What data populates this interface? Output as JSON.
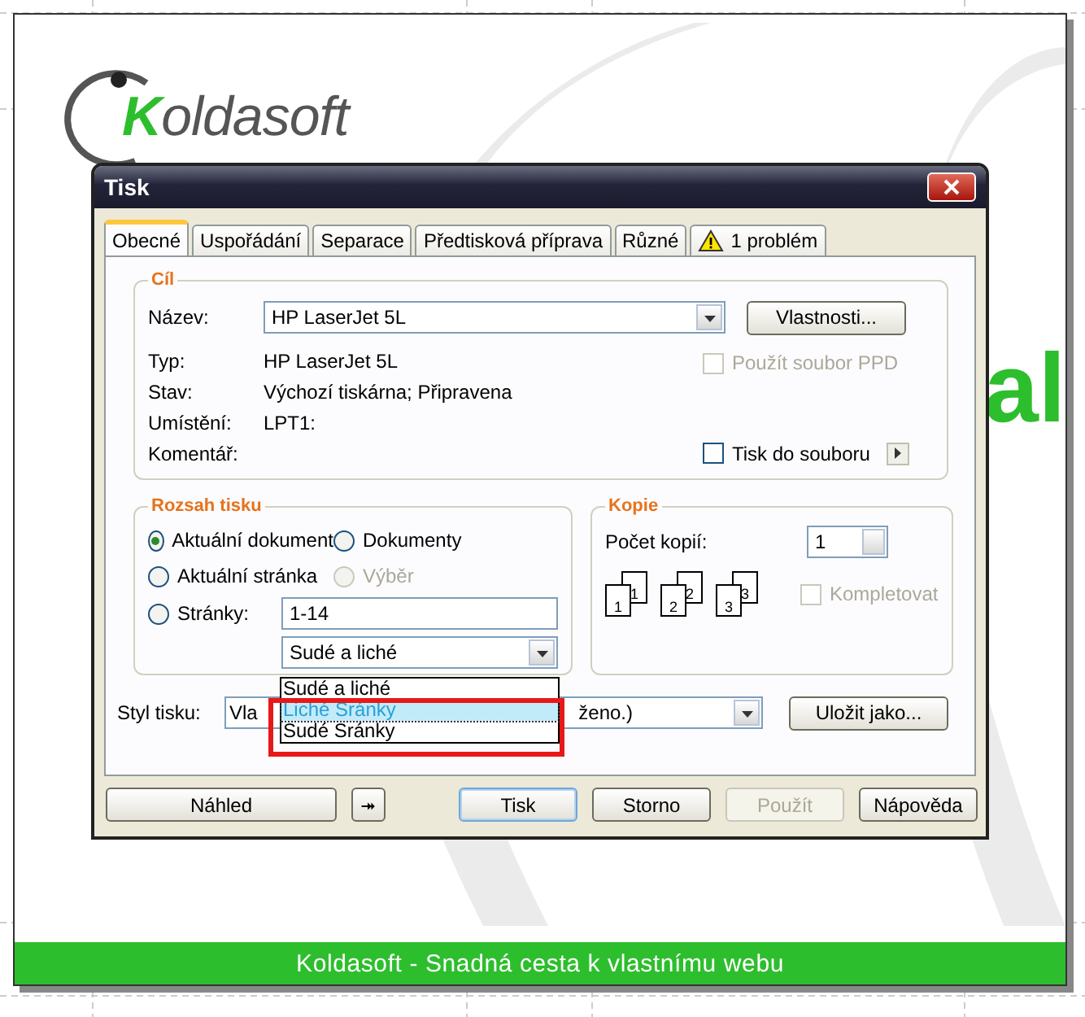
{
  "logo": {
    "initial": "K",
    "rest": "oldasoft"
  },
  "background_text": "al",
  "footer": "Koldasoft - Snadná cesta k vlastnímu webu",
  "dialog": {
    "title": "Tisk",
    "tabs": [
      {
        "label": "Obecné",
        "selected": true
      },
      {
        "label": "Uspořádání",
        "selected": false
      },
      {
        "label": "Separace",
        "selected": false
      },
      {
        "label": "Předtisková příprava",
        "selected": false
      },
      {
        "label": "Různé",
        "selected": false
      },
      {
        "label": "1 problém",
        "selected": false,
        "kind": "warning"
      }
    ],
    "target": {
      "title": "Cíl",
      "name_label": "Název:",
      "name_value": "HP LaserJet 5L",
      "properties_button": "Vlastnosti...",
      "info": [
        {
          "label": "Typ:",
          "value": "HP LaserJet 5L"
        },
        {
          "label": "Stav:",
          "value": "Výchozí tiskárna; Připravena"
        },
        {
          "label": "Umístění:",
          "value": "LPT1:"
        },
        {
          "label": "Komentář:"
        }
      ],
      "ppd": {
        "label": "Použít soubor PPD",
        "checked": false,
        "disabled": true
      },
      "print_to_file": {
        "label": "Tisk do souboru",
        "checked": false,
        "disabled": false
      }
    },
    "range": {
      "title": "Rozsah tisku",
      "options": [
        {
          "label": "Aktuální dokument",
          "selected": true,
          "disabled": false
        },
        {
          "label": "Dokumenty",
          "selected": false,
          "disabled": false
        },
        {
          "label": "Aktuální stránka",
          "selected": false,
          "disabled": false
        },
        {
          "label": "Výběr",
          "selected": false,
          "disabled": true
        },
        {
          "label": "Stránky:",
          "selected": false,
          "disabled": false
        }
      ],
      "pages_value": "1-14",
      "parity_value": "Sudé a liché",
      "parity_list": [
        {
          "label": "Sudé a liché",
          "selected": false
        },
        {
          "label": "Liché Sránky",
          "selected": true
        },
        {
          "label": "Sudé Sránky",
          "selected": false
        }
      ]
    },
    "copies": {
      "title": "Kopie",
      "count_label": "Počet kopií:",
      "count_value": "1",
      "collate_pages": [
        {
          "front": "1",
          "back": "1"
        },
        {
          "front": "2",
          "back": "2"
        },
        {
          "front": "3",
          "back": "3"
        }
      ],
      "collate": {
        "label": "Kompletovat",
        "checked": false,
        "disabled": true
      }
    },
    "style": {
      "label": "Styl tisku:",
      "value_start": "Vla",
      "value_end": "ženo.)",
      "save_button": "Uložit jako..."
    },
    "buttons": [
      {
        "label": "Náhled",
        "disabled": false,
        "default": false,
        "kind": "wide"
      },
      {
        "label": "⯮",
        "disabled": false,
        "default": false,
        "kind": "icon"
      },
      {
        "label": "Tisk",
        "disabled": false,
        "default": true,
        "kind": "normal"
      },
      {
        "label": "Storno",
        "disabled": false,
        "default": false,
        "kind": "normal"
      },
      {
        "label": "Použít",
        "disabled": true,
        "default": false,
        "kind": "normal"
      },
      {
        "label": "Nápověda",
        "disabled": false,
        "default": false,
        "kind": "normal"
      }
    ]
  }
}
